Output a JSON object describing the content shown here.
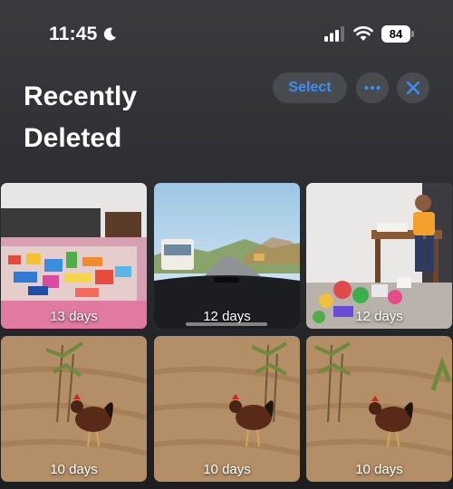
{
  "status_bar": {
    "time": "11:45",
    "battery_level": "84",
    "icons": [
      "moon-icon",
      "signal-icon",
      "wifi-icon",
      "battery-icon"
    ]
  },
  "header": {
    "title": "Recently Deleted",
    "select_label": "Select",
    "more_icon": "ellipsis-icon",
    "close_icon": "close-icon"
  },
  "colors": {
    "accent": "#3e8ef7",
    "header_bg": "#2c2d30"
  },
  "photos": [
    {
      "days": "13 days",
      "subject": "toys-on-bed"
    },
    {
      "days": "12 days",
      "subject": "road-from-car"
    },
    {
      "days": "12 days",
      "subject": "child-with-toys"
    },
    {
      "days": "10 days",
      "subject": "rooster"
    },
    {
      "days": "10 days",
      "subject": "rooster"
    },
    {
      "days": "10 days",
      "subject": "rooster"
    }
  ]
}
